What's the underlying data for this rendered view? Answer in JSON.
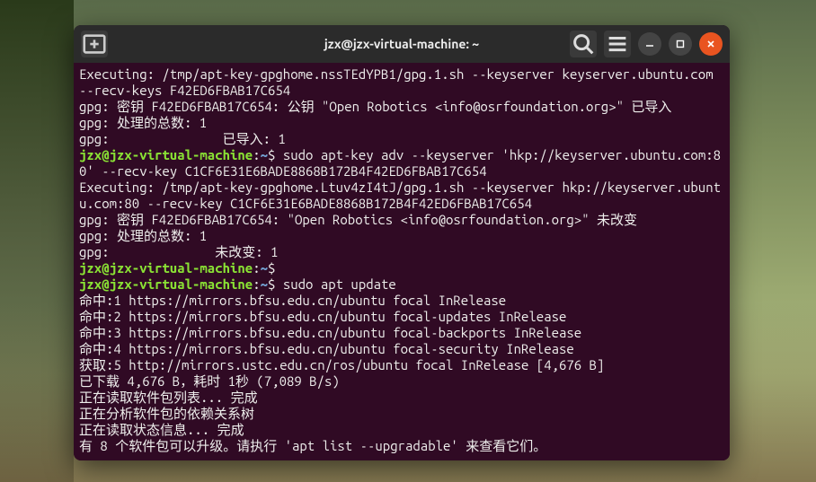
{
  "window": {
    "title": "jzx@jzx-virtual-machine: ~"
  },
  "titlebar": {
    "newtab_icon": "new-tab-icon",
    "search_icon": "search-icon",
    "menu_icon": "hamburger-icon",
    "min_icon": "minimize-icon",
    "max_icon": "maximize-icon",
    "close_icon": "close-icon"
  },
  "prompt": {
    "userhost": "jzx@jzx-virtual-machine",
    "sep": ":",
    "path": "~",
    "sigil": "$"
  },
  "lines": {
    "l01": "Executing: /tmp/apt-key-gpghome.nssTEdYPB1/gpg.1.sh --keyserver keyserver.ubuntu.com --recv-keys F42ED6FBAB17C654",
    "l02": "gpg: 密钥 F42ED6FBAB17C654: 公钥 \"Open Robotics <info@osrfoundation.org>\" 已导入",
    "l03": "gpg: 处理的总数: 1",
    "l04": "gpg:               已导入: 1",
    "cmd1": " sudo apt-key adv --keyserver 'hkp://keyserver.ubuntu.com:80' --recv-key C1CF6E31E6BADE8868B172B4F42ED6FBAB17C654",
    "l05": "Executing: /tmp/apt-key-gpghome.Ltuv4zI4tJ/gpg.1.sh --keyserver hkp://keyserver.ubuntu.com:80 --recv-key C1CF6E31E6BADE8868B172B4F42ED6FBAB17C654",
    "l06": "gpg: 密钥 F42ED6FBAB17C654: \"Open Robotics <info@osrfoundation.org>\" 未改变",
    "l07": "gpg: 处理的总数: 1",
    "l08": "gpg:              未改变: 1",
    "cmd2": "",
    "cmd3": " sudo apt update",
    "l09": "命中:1 https://mirrors.bfsu.edu.cn/ubuntu focal InRelease",
    "l10": "命中:2 https://mirrors.bfsu.edu.cn/ubuntu focal-updates InRelease",
    "l11": "命中:3 https://mirrors.bfsu.edu.cn/ubuntu focal-backports InRelease",
    "l12": "命中:4 https://mirrors.bfsu.edu.cn/ubuntu focal-security InRelease",
    "l13": "获取:5 http://mirrors.ustc.edu.cn/ros/ubuntu focal InRelease [4,676 B]",
    "l14": "已下载 4,676 B，耗时 1秒 (7,089 B/s)",
    "l15": "正在读取软件包列表... 完成",
    "l16": "正在分析软件包的依赖关系树",
    "l17": "正在读取状态信息... 完成",
    "l18": "有 8 个软件包可以升级。请执行 'apt list --upgradable' 来查看它们。"
  }
}
